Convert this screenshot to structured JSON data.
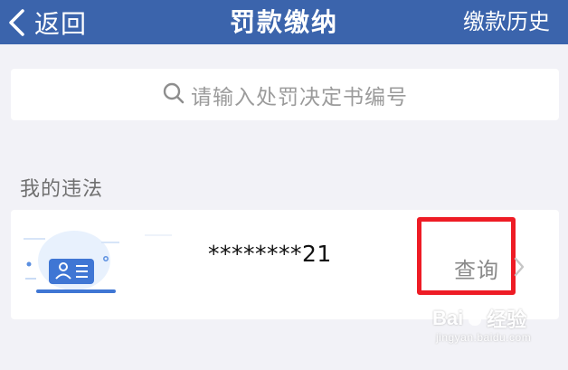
{
  "header": {
    "back_label": "返回",
    "title": "罚款缴纳",
    "history_label": "缴款历史"
  },
  "search": {
    "placeholder": "请输入处罚决定书编号",
    "icon": "search-icon"
  },
  "section": {
    "title": "我的违法"
  },
  "violation": {
    "plate_number": "********21",
    "action_label": "查询",
    "icon": "id-card-icon"
  },
  "watermark": {
    "brand_prefix": "Bai",
    "brand_suffix": "经验",
    "url": "jingyan.baidu.com"
  },
  "colors": {
    "header_bg": "#3b64ac",
    "page_bg": "#f2f2f7",
    "highlight_box": "#ee1c25",
    "card_icon_blue": "#3f76d4"
  }
}
